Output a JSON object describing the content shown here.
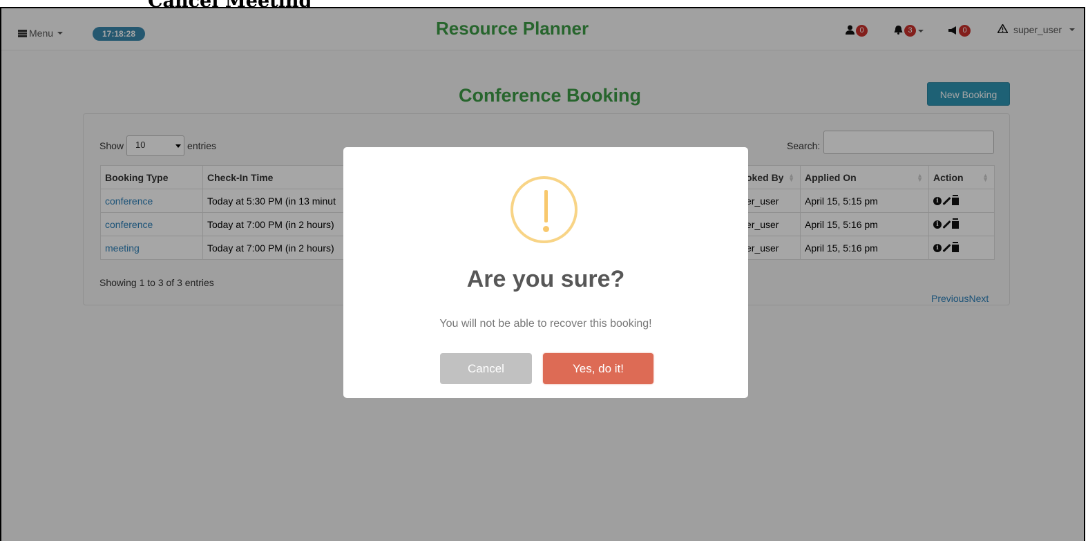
{
  "caption": "Cancel Meeting",
  "navbar": {
    "menu_label": "Menu",
    "clock": "17:18:28",
    "brand": "Resource Planner",
    "user_badge": "0",
    "bell_badge": "3",
    "announce_badge": "0",
    "username": "super_user"
  },
  "page": {
    "title": "Conference Booking",
    "new_booking": "New Booking"
  },
  "table_controls": {
    "show_label": "Show",
    "entries_value": "10",
    "entries_label": "entries",
    "search_label": "Search:",
    "showing": "Showing 1 to 3 of 3 entries",
    "previous": "Previous",
    "next": "Next"
  },
  "table": {
    "headers": [
      "Booking Type",
      "Check-In Time",
      "oked By",
      "Applied On",
      "Action"
    ],
    "rows": [
      {
        "type": "conference",
        "checkin": "Today at 5:30 PM (in 13 minut",
        "booked_by": "er_user",
        "applied_on": "April 15, 5:15 pm"
      },
      {
        "type": "conference",
        "checkin": "Today at 7:00 PM (in 2 hours)",
        "booked_by": "er_user",
        "applied_on": "April 15, 5:16 pm"
      },
      {
        "type": "meeting",
        "checkin": "Today at 7:00 PM (in 2 hours)",
        "booked_by": "er_user",
        "applied_on": "April 15, 5:16 pm"
      }
    ]
  },
  "modal": {
    "icon": "warning-icon",
    "title": "Are you sure?",
    "text": "You will not be able to recover this booking!",
    "cancel": "Cancel",
    "confirm": "Yes, do it!"
  },
  "colors": {
    "brand": "#3d9b45",
    "primary": "#2f96b4",
    "link": "#2a7fb8",
    "danger": "#dd6b55",
    "warning": "#f8d486",
    "badge": "#c9302c"
  }
}
